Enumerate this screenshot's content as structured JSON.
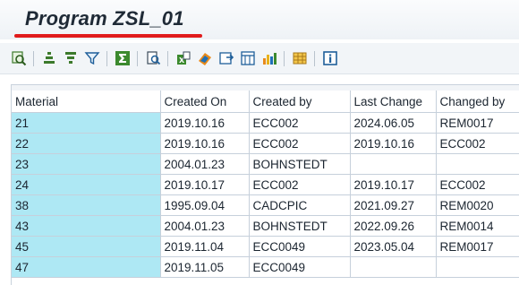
{
  "title": "Program ZSL_01",
  "toolbar": {
    "icons": [
      "details-icon",
      "sort-ascending-icon",
      "sort-descending-icon",
      "filter-icon",
      "sum-icon",
      "print-preview-icon",
      "export-icon",
      "abc-analysis-icon",
      "view-icon",
      "layout-icon",
      "graphic-icon",
      "select-layout-icon",
      "information-icon"
    ]
  },
  "table": {
    "headers": [
      "Material",
      "Created On",
      "Created by",
      "Last Change",
      "Changed by"
    ],
    "rows": [
      [
        "21",
        "2019.10.16",
        "ECC002",
        "2024.06.05",
        "REM0017"
      ],
      [
        "22",
        "2019.10.16",
        "ECC002",
        "2019.10.16",
        "ECC002"
      ],
      [
        "23",
        "2004.01.23",
        "BOHNSTEDT",
        "",
        ""
      ],
      [
        "24",
        "2019.10.17",
        "ECC002",
        "2019.10.17",
        "ECC002"
      ],
      [
        "38",
        "1995.09.04",
        "CADCPIC",
        "2021.09.27",
        "REM0020"
      ],
      [
        "43",
        "2004.01.23",
        "BOHNSTEDT",
        "2022.09.26",
        "REM0014"
      ],
      [
        "45",
        "2019.11.04",
        "ECC0049",
        "2023.05.04",
        "REM0017"
      ],
      [
        "47",
        "2019.11.05",
        "ECC0049",
        "",
        ""
      ]
    ]
  },
  "colors": {
    "key_column": "#aee8f4",
    "accent": "#e01b1b"
  }
}
